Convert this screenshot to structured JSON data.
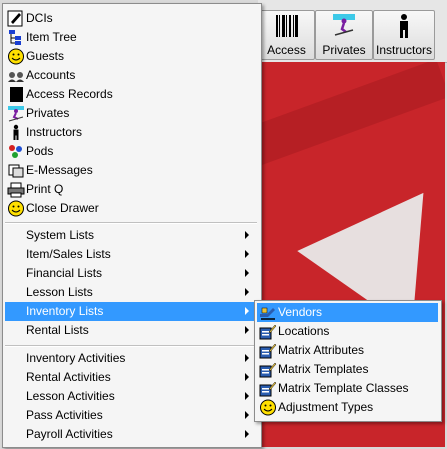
{
  "toolbar": {
    "buttons": [
      {
        "label": "Access",
        "icon": "barcode-icon"
      },
      {
        "label": "Privates",
        "icon": "skier-icon"
      },
      {
        "label": "Instructors",
        "icon": "person-icon"
      }
    ]
  },
  "main_menu": {
    "top_items": [
      {
        "label": "DCIs",
        "icon": "edit-icon"
      },
      {
        "label": "Item Tree",
        "icon": "tree-icon"
      },
      {
        "label": "Guests",
        "icon": "smiley-icon"
      },
      {
        "label": "Accounts",
        "icon": "accounts-icon"
      },
      {
        "label": "Access Records",
        "icon": "record-icon"
      },
      {
        "label": "Privates",
        "icon": "skier-icon"
      },
      {
        "label": "Instructors",
        "icon": "person-icon"
      },
      {
        "label": "Pods",
        "icon": "pods-icon"
      },
      {
        "label": "E-Messages",
        "icon": "message-icon"
      },
      {
        "label": "Print Q",
        "icon": "print-icon"
      },
      {
        "label": "Close Drawer",
        "icon": "smiley-icon"
      }
    ],
    "list_items": [
      {
        "label": "System Lists"
      },
      {
        "label": "Item/Sales Lists"
      },
      {
        "label": "Financial Lists"
      },
      {
        "label": "Lesson Lists"
      },
      {
        "label": "Inventory Lists",
        "active": true
      },
      {
        "label": "Rental Lists"
      }
    ],
    "activity_items": [
      {
        "label": "Inventory Activities"
      },
      {
        "label": "Rental Activities"
      },
      {
        "label": "Lesson Activities"
      },
      {
        "label": "Pass Activities"
      },
      {
        "label": "Payroll Activities"
      }
    ]
  },
  "sub_menu": {
    "items": [
      {
        "label": "Vendors",
        "icon": "vendor-icon",
        "active": true
      },
      {
        "label": "Locations",
        "icon": "list-edit-icon"
      },
      {
        "label": "Matrix Attributes",
        "icon": "list-edit-icon"
      },
      {
        "label": "Matrix Templates",
        "icon": "list-edit-icon"
      },
      {
        "label": "Matrix Template Classes",
        "icon": "list-edit-icon"
      },
      {
        "label": "Adjustment Types",
        "icon": "smiley-icon"
      }
    ]
  },
  "colors": {
    "highlight": "#3399ff",
    "background_red": "#c8252a",
    "menu_bg": "#f5f5f5"
  }
}
